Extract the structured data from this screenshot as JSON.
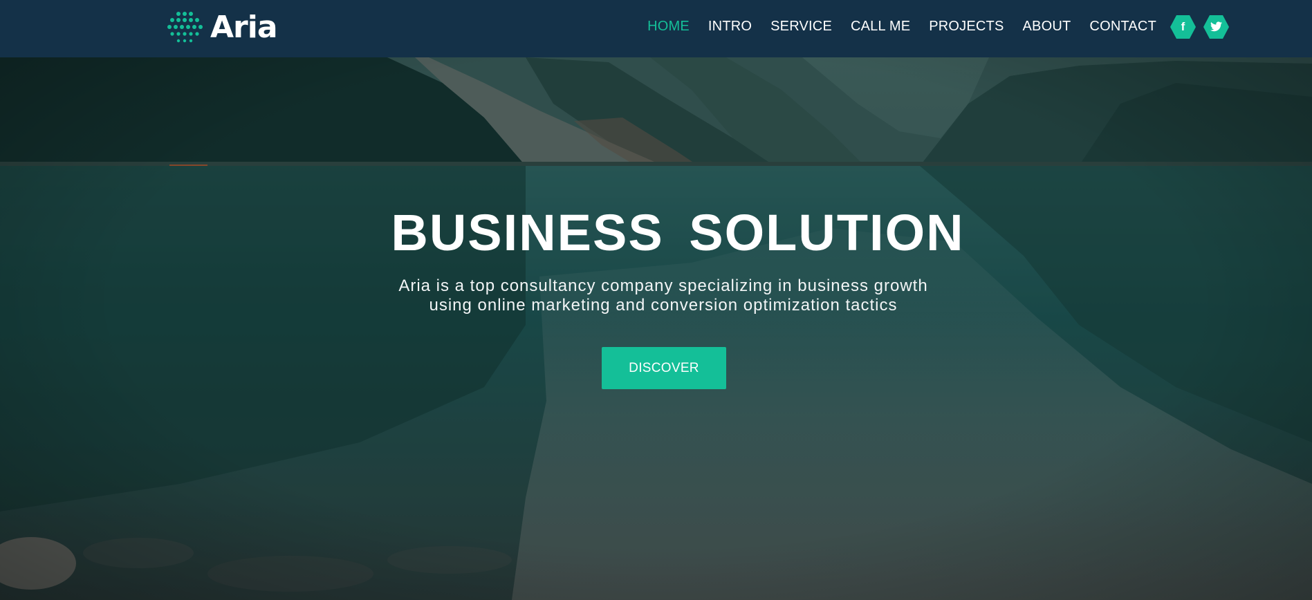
{
  "brand": {
    "name": "Aria",
    "mark_icon": "dotted-circle-logo"
  },
  "nav": {
    "items": [
      {
        "label": "HOME",
        "active": true
      },
      {
        "label": "INTRO",
        "active": false
      },
      {
        "label": "SERVICE",
        "active": false
      },
      {
        "label": "CALL ME",
        "active": false
      },
      {
        "label": "PROJECTS",
        "active": false
      },
      {
        "label": "ABOUT",
        "active": false
      },
      {
        "label": "CONTACT",
        "active": false
      }
    ],
    "social": [
      {
        "icon": "facebook-icon",
        "glyph": "f"
      },
      {
        "icon": "twitter-icon"
      }
    ]
  },
  "hero": {
    "title": "BUSINESS SOLUTION",
    "subtitle_line_1": "Aria is a top consultancy company specializing in business growth",
    "subtitle_line_2": "using online marketing and conversion optimization tactics",
    "cta_label": "DISCOVER"
  },
  "colors": {
    "navbar": "#143148",
    "accent": "#14bf98",
    "text": "#ffffff",
    "lake": "#1f5d5c"
  }
}
